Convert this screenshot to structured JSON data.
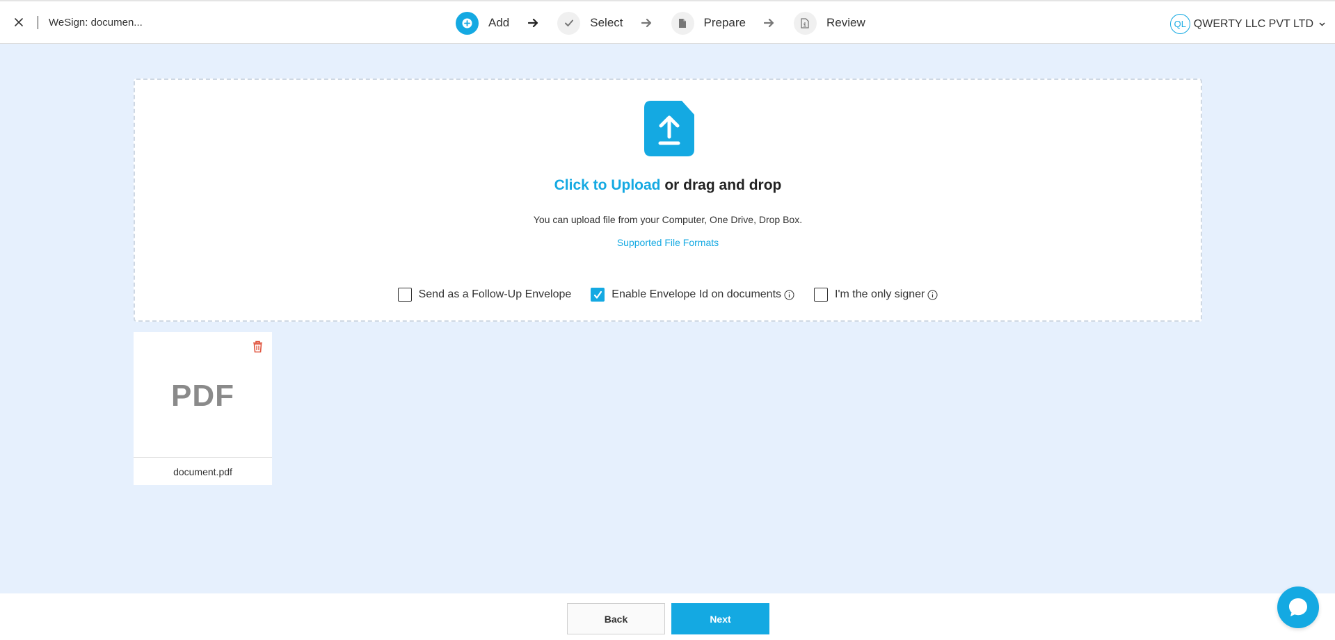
{
  "header": {
    "document_title": "WeSign: documen...",
    "steps": [
      {
        "label": "Add",
        "icon": "plus-circle-icon",
        "active": true
      },
      {
        "label": "Select",
        "icon": "check-icon",
        "active": false
      },
      {
        "label": "Prepare",
        "icon": "document-icon",
        "active": false
      },
      {
        "label": "Review",
        "icon": "document-review-icon",
        "active": false
      }
    ],
    "org": {
      "initials": "QL",
      "name": "QWERTY LLC PVT LTD"
    }
  },
  "upload": {
    "link_text": "Click to Upload",
    "rest_text": "or drag and drop",
    "subtitle": "You can upload file from your Computer, One Drive, Drop Box.",
    "formats_link": "Supported File Formats"
  },
  "options": [
    {
      "label": "Send as a Follow-Up Envelope",
      "checked": false,
      "info": false
    },
    {
      "label": "Enable Envelope Id on documents",
      "checked": true,
      "info": true
    },
    {
      "label": "I'm the only signer",
      "checked": false,
      "info": true
    }
  ],
  "file": {
    "type_label": "PDF",
    "name": "document.pdf"
  },
  "footer": {
    "back_label": "Back",
    "next_label": "Next"
  },
  "colors": {
    "accent": "#14a9e2",
    "background": "#e6f0fd",
    "delete": "#e0533d"
  }
}
